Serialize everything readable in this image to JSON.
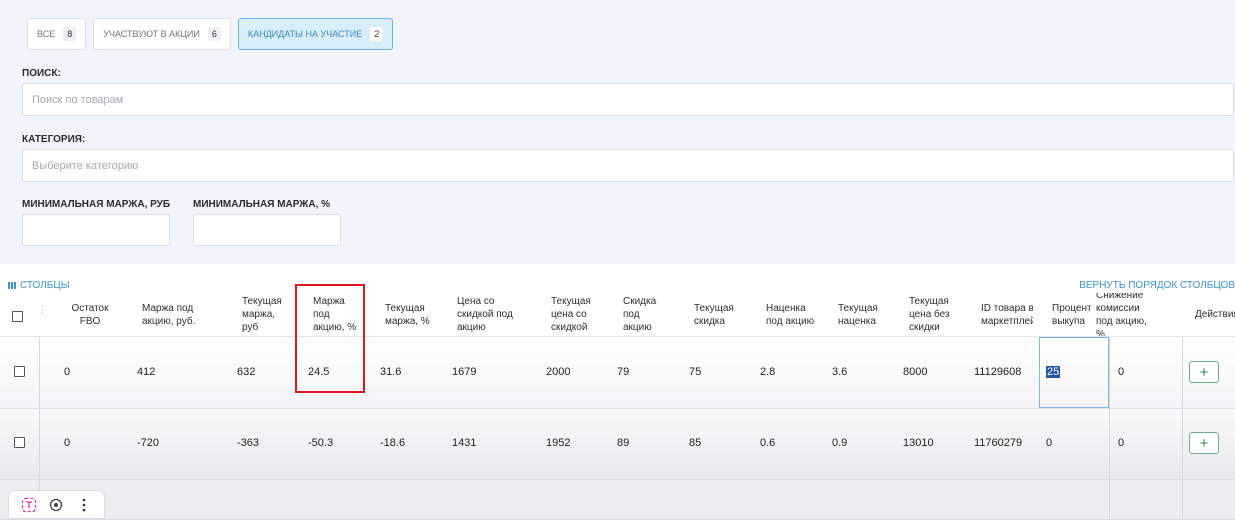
{
  "tabs": [
    {
      "label": "ВСЕ",
      "count": "8"
    },
    {
      "label": "УЧАСТВУЮТ В АКЦИИ",
      "count": "6"
    },
    {
      "label": "КАНДИДАТЫ НА УЧАСТИЕ",
      "count": "2"
    }
  ],
  "search": {
    "label": "ПОИСК:",
    "placeholder": "Поиск по товарам"
  },
  "category": {
    "label": "КАТЕГОРИЯ:",
    "placeholder": "Выберите категорию"
  },
  "min_margin_rub": {
    "label": "МИНИМАЛЬНАЯ МАРЖА, РУБ",
    "value": ""
  },
  "min_margin_pct": {
    "label": "МИНИМАЛЬНАЯ МАРЖА, %",
    "value": ""
  },
  "toolbar": {
    "columns_label": "СТОЛБЦЫ",
    "reset_order_label": "ВЕРНУТЬ ПОРЯДОК СТОЛБЦОВ"
  },
  "table": {
    "headers": [
      "Остаток FBO",
      "Маржа под акцию, руб.",
      "Текущая маржа, руб",
      "Маржа под акцию, %",
      "Текущая маржа, %",
      "Цена со скидкой под акцию",
      "Текущая цена со скидкой",
      "Скидка под акцию",
      "Текущая скидка",
      "Наценка под акцию",
      "Текущая наценка",
      "Текущая цена без скидки",
      "ID товара в маркетплейсе",
      "Процент выкупа",
      "Снижение комиссии под акцию, %",
      "Действия"
    ],
    "rows": [
      [
        "0",
        "412",
        "632",
        "24.5",
        "31.6",
        "1679",
        "2000",
        "79",
        "75",
        "2.8",
        "3.6",
        "8000",
        "11129608",
        "25",
        "0"
      ],
      [
        "0",
        "-720",
        "-363",
        "-50.3",
        "-18.6",
        "1431",
        "1952",
        "89",
        "85",
        "0.6",
        "0.9",
        "13010",
        "11760279",
        "0",
        "0"
      ]
    ],
    "row_action": "+"
  },
  "colors": {
    "accent": "#3a95cf",
    "highlight": "#e0161f",
    "add_button": "#2f8a57"
  }
}
